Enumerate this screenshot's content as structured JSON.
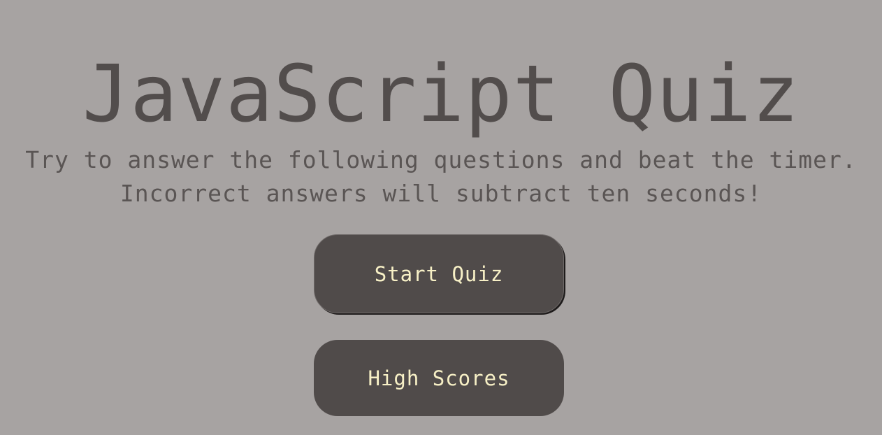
{
  "title": "JavaScript Quiz",
  "subtitle": {
    "line1": "Try to answer the following questions and beat the timer.",
    "line2": "Incorrect answers will subtract ten seconds!"
  },
  "buttons": {
    "start_label": "Start Quiz",
    "high_scores_label": "High Scores"
  },
  "colors": {
    "background": "#a7a3a2",
    "text": "#524d4c",
    "button_bg": "#504b4a",
    "button_text": "#f7f0c6"
  }
}
